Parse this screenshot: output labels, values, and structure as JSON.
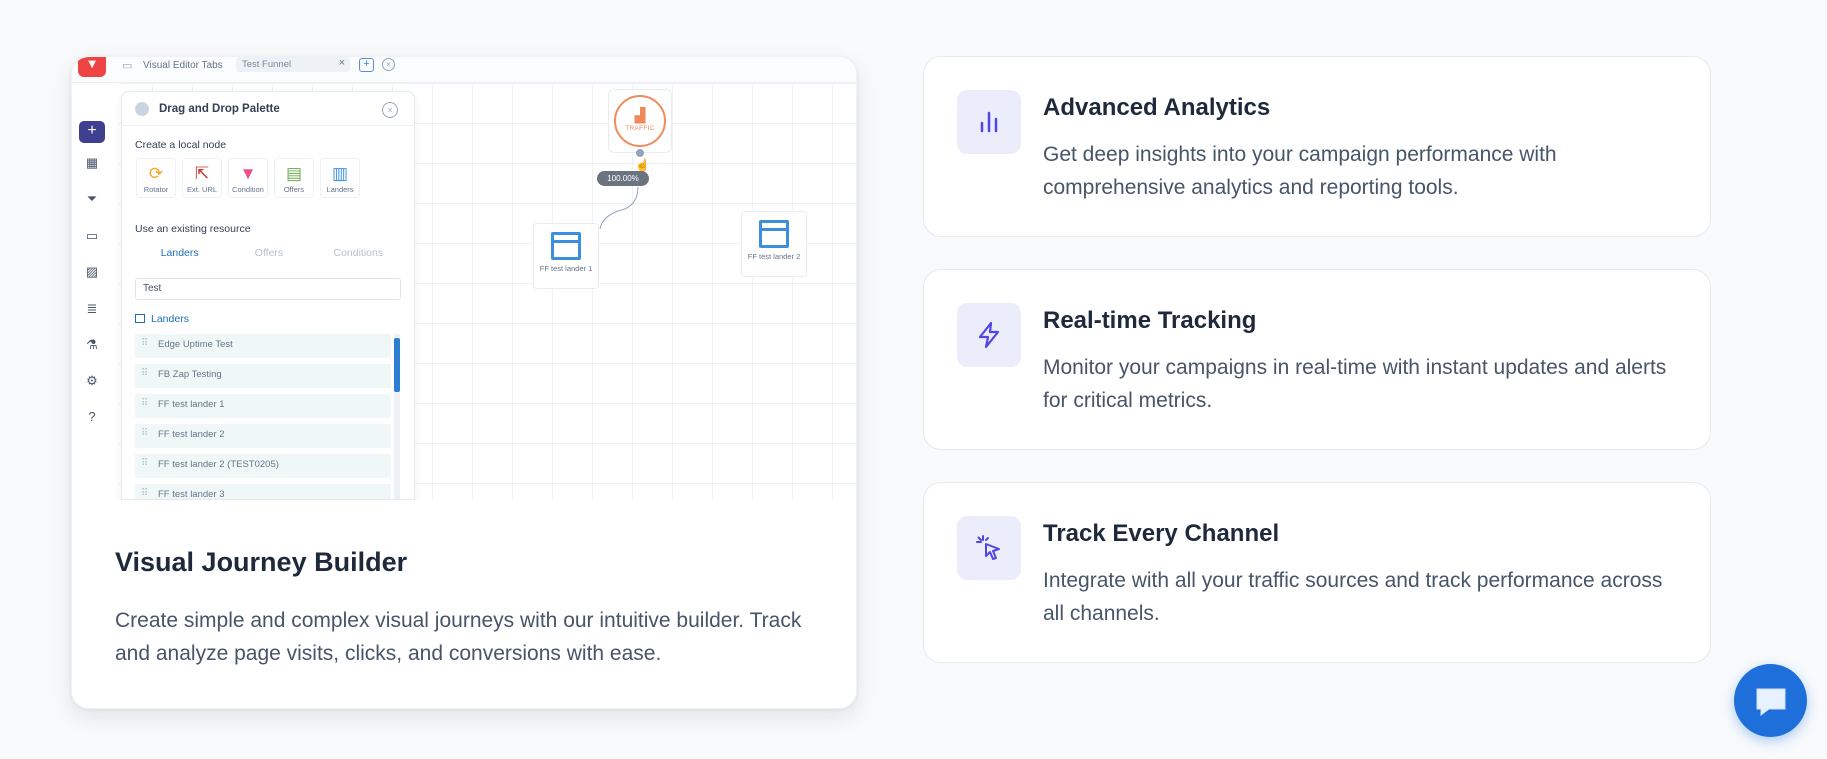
{
  "hero": {
    "title": "Visual Journey Builder",
    "description": "Create simple and complex visual journeys with our intuitive builder. Track and analyze page visits, clicks, and conversions with ease.",
    "screenshot": {
      "topbar": {
        "editor_title": "Visual Editor Tabs",
        "active_tab": "Test Funnel",
        "tab_close": "×",
        "add_tab": "+",
        "close_all": "×"
      },
      "rail": {
        "add": "+",
        "icons": [
          "dashboard-icon",
          "funnel-icon",
          "folder-icon",
          "chart-icon",
          "database-icon",
          "flask-icon",
          "settings-icon",
          "help-icon"
        ]
      },
      "palette": {
        "title": "Drag and Drop Palette",
        "close": "×",
        "local_node_label": "Create a local node",
        "nodes": [
          {
            "label": "Rotator",
            "glyph": "⟳",
            "color": "#f5a623"
          },
          {
            "label": "Ext. URL",
            "glyph": "⇱",
            "color": "#c0392b"
          },
          {
            "label": "Condition",
            "glyph": "▼",
            "color": "#ee4d86"
          },
          {
            "label": "Offers",
            "glyph": "▤",
            "color": "#6aa84f"
          },
          {
            "label": "Landers",
            "glyph": "▥",
            "color": "#3b8fdc"
          }
        ],
        "existing_label": "Use an existing resource",
        "resource_tabs": [
          "Landers",
          "Offers",
          "Conditions"
        ],
        "search_value": "Test",
        "group_label": "Landers",
        "items": [
          "Edge Uptime Test",
          "FB Zap Testing",
          "FF test lander 1",
          "FF test lander 2",
          "FF test lander 2 (TEST0205)",
          "FF test lander 3"
        ]
      },
      "flow": {
        "traffic_label": "TRAFFIC",
        "split_label": "100.00%",
        "lander_1": "FF test lander 1",
        "lander_2": "FF test lander 2"
      }
    }
  },
  "features": [
    {
      "title": "Advanced Analytics",
      "description": "Get deep insights into your campaign performance with comprehensive analytics and reporting tools.",
      "icon": "bar-chart-icon"
    },
    {
      "title": "Real-time Tracking",
      "description": "Monitor your campaigns in real-time with instant updates and alerts for critical metrics.",
      "icon": "lightning-icon"
    },
    {
      "title": "Track Every Channel",
      "description": "Integrate with all your traffic sources and track performance across all channels.",
      "icon": "pointer-click-icon"
    }
  ],
  "chat": {
    "icon": "chat-bubble-icon"
  },
  "colors": {
    "accent": "#4f46e5",
    "icon_bg": "#ecedfb",
    "chat": "#1e6fd9",
    "traffic": "#f08a5d",
    "lander_blue": "#3b8fdc"
  }
}
